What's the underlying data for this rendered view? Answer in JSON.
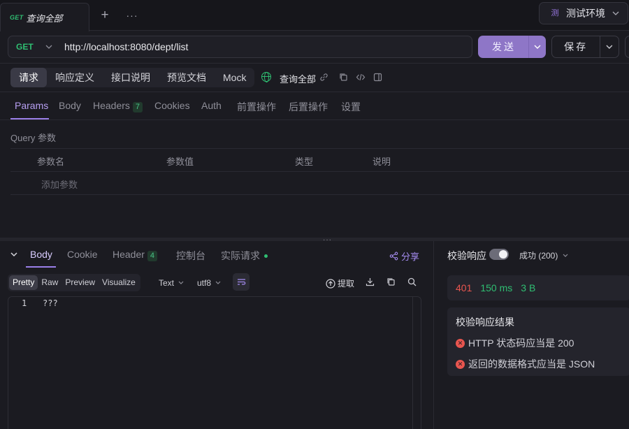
{
  "tab": {
    "method": "GET",
    "title": "查询全部"
  },
  "toolbar": {
    "plus": "+",
    "more": "···"
  },
  "env": {
    "badge": "测",
    "label": "测试环境"
  },
  "request": {
    "method": "GET",
    "url": "http://localhost:8080/dept/list",
    "send_label": "发送",
    "save_label": "保存"
  },
  "segments": [
    "请求",
    "响应定义",
    "接口说明",
    "预览文档",
    "Mock"
  ],
  "segment_name": "查询全部",
  "subtabs": {
    "params": "Params",
    "body": "Body",
    "headers": "Headers",
    "headers_count": "7",
    "cookies": "Cookies",
    "auth": "Auth",
    "pre": "前置操作",
    "post": "后置操作",
    "settings": "设置"
  },
  "query": {
    "title": "Query 参数",
    "headers": [
      "参数名",
      "参数值",
      "类型",
      "说明"
    ],
    "add_label": "添加参数"
  },
  "response": {
    "tabs": {
      "body": "Body",
      "cookie": "Cookie",
      "header": "Header",
      "header_count": "4",
      "console": "控制台",
      "actual": "实际请求"
    },
    "share": "分享",
    "formats": [
      "Pretty",
      "Raw",
      "Preview",
      "Visualize"
    ],
    "text_sel": "Text",
    "enc_sel": "utf8",
    "extract": "提取",
    "line_no": "1",
    "code": "???"
  },
  "validation": {
    "title": "校验响应",
    "status_select": "成功 (200)",
    "status_code": "401",
    "time": "150 ms",
    "size": "3 B",
    "result_title": "校验响应结果",
    "results": [
      "HTTP 状态码应当是 200",
      "返回的数据格式应当是 JSON"
    ],
    "colors": {
      "error": "#e8554f",
      "success": "#2fbe72",
      "accent": "#8e76c7"
    }
  }
}
